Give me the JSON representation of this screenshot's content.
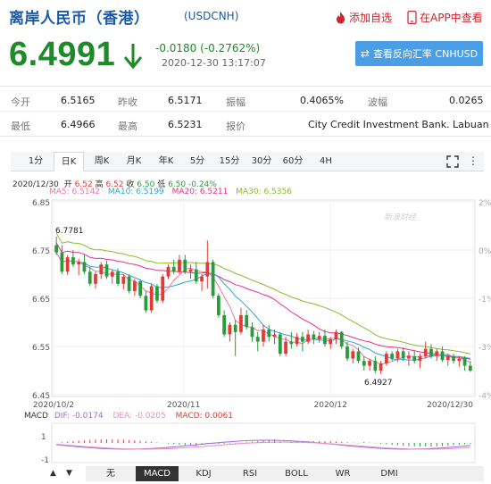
{
  "header": {
    "title": "离岸人民币（香港）",
    "symbol": "(USDCNH)",
    "favorite_label": "添加自选",
    "app_label": "在APP中查看"
  },
  "quote": {
    "price": "6.4991",
    "change": "-0.0180 (-0.2762%)",
    "datetime": "2020-12-30 13:17:07",
    "direction": "down",
    "reverse_button": "查看反向汇率 CNHUSD"
  },
  "stats": {
    "open_label": "今开",
    "open": "6.5165",
    "prev_close_label": "昨收",
    "prev_close": "6.5171",
    "amplitude_label": "振幅",
    "amplitude": "0.4065%",
    "wave_label": "波幅",
    "wave": "0.0265",
    "low_label": "最低",
    "low": "6.4966",
    "high_label": "最高",
    "high": "6.5231",
    "quote_label": "报价",
    "quote_source": "City Credit Investment Bank. Labuan"
  },
  "tabs": [
    "1分",
    "日K",
    "周K",
    "月K",
    "年K",
    "5分",
    "15分",
    "30分",
    "60分",
    "4H"
  ],
  "active_tab": "日K",
  "chart_info": {
    "date": "2020/12/30",
    "open_label": "开",
    "open": "6.52",
    "high_label": "高",
    "high": "6.52",
    "close_label": "收",
    "close": "6.50",
    "low_label": "低",
    "low": "6.50",
    "change": "-0.24%",
    "ma5": "MA5: 6.5142",
    "ma10": "MA10: 6.5199",
    "ma20": "MA20: 6.5211",
    "ma30": "MA30: 6.5356",
    "watermark": "新浪财经"
  },
  "macd_info": {
    "label": "MACD",
    "dif": "DIF: -0.0174",
    "dea": "DEA: -0.0205",
    "macd": "MACD: 0.0061"
  },
  "bottom_tabs": [
    "无",
    "MACD",
    "KDJ",
    "RSI",
    "BOLL",
    "WR",
    "DMI"
  ],
  "bottom_active": "MACD",
  "colors": {
    "up": "#e33a34",
    "down": "#2a9b3a",
    "ma5": "#e978a8",
    "ma10": "#28a7d8",
    "ma20": "#e8308a",
    "ma30": "#8fb92d",
    "dif": "#9a6be0",
    "dea": "#e88fbe",
    "brand": "#1a5aa6"
  },
  "chart_data": {
    "type": "candlestick",
    "y_ticks": [
      "6.85",
      "6.75",
      "6.65",
      "6.55",
      "6.45"
    ],
    "ylim": [
      6.45,
      6.85
    ],
    "pct_ticks": [
      "2%",
      "0%",
      "-1%",
      "-3%",
      "-4%"
    ],
    "x_ticks": [
      "2020/10/2",
      "2020/11",
      "2020/12",
      "2020/12/30"
    ],
    "annotations": {
      "max": "6.7781",
      "min": "6.4927"
    },
    "macd_ticks": [
      "1",
      "-1"
    ],
    "candles": [
      [
        6.76,
        6.778,
        6.74,
        6.745
      ],
      [
        6.745,
        6.76,
        6.7,
        6.705
      ],
      [
        6.705,
        6.74,
        6.698,
        6.735
      ],
      [
        6.735,
        6.75,
        6.715,
        6.72
      ],
      [
        6.72,
        6.732,
        6.698,
        6.725
      ],
      [
        6.725,
        6.74,
        6.7,
        6.705
      ],
      [
        6.705,
        6.715,
        6.675,
        6.68
      ],
      [
        6.68,
        6.705,
        6.67,
        6.7
      ],
      [
        6.7,
        6.725,
        6.69,
        6.72
      ],
      [
        6.72,
        6.728,
        6.69,
        6.695
      ],
      [
        6.695,
        6.71,
        6.68,
        6.705
      ],
      [
        6.705,
        6.712,
        6.675,
        6.68
      ],
      [
        6.68,
        6.7,
        6.668,
        6.695
      ],
      [
        6.695,
        6.7,
        6.66,
        6.665
      ],
      [
        6.665,
        6.69,
        6.655,
        6.685
      ],
      [
        6.685,
        6.688,
        6.65,
        6.655
      ],
      [
        6.655,
        6.665,
        6.62,
        6.625
      ],
      [
        6.625,
        6.68,
        6.62,
        6.675
      ],
      [
        6.675,
        6.68,
        6.64,
        6.645
      ],
      [
        6.645,
        6.7,
        6.64,
        6.695
      ],
      [
        6.695,
        6.72,
        6.69,
        6.715
      ],
      [
        6.715,
        6.73,
        6.7,
        6.705
      ],
      [
        6.705,
        6.74,
        6.7,
        6.73
      ],
      [
        6.73,
        6.74,
        6.7,
        6.705
      ],
      [
        6.705,
        6.72,
        6.69,
        6.71
      ],
      [
        6.71,
        6.725,
        6.68,
        6.685
      ],
      [
        6.685,
        6.7,
        6.665,
        6.695
      ],
      [
        6.695,
        6.77,
        6.67,
        6.725
      ],
      [
        6.725,
        6.73,
        6.65,
        6.655
      ],
      [
        6.655,
        6.66,
        6.61,
        6.615
      ],
      [
        6.615,
        6.625,
        6.57,
        6.575
      ],
      [
        6.575,
        6.6,
        6.56,
        6.595
      ],
      [
        6.595,
        6.605,
        6.53,
        6.58
      ],
      [
        6.58,
        6.63,
        6.575,
        6.615
      ],
      [
        6.615,
        6.625,
        6.585,
        6.59
      ],
      [
        6.59,
        6.6,
        6.56,
        6.57
      ],
      [
        6.57,
        6.58,
        6.54,
        6.56
      ],
      [
        6.56,
        6.595,
        6.55,
        6.585
      ],
      [
        6.585,
        6.595,
        6.56,
        6.57
      ],
      [
        6.57,
        6.585,
        6.555,
        6.575
      ],
      [
        6.575,
        6.58,
        6.53,
        6.535
      ],
      [
        6.535,
        6.57,
        6.53,
        6.56
      ],
      [
        6.56,
        6.58,
        6.545,
        6.555
      ],
      [
        6.555,
        6.578,
        6.55,
        6.57
      ],
      [
        6.57,
        6.58,
        6.54,
        6.56
      ],
      [
        6.56,
        6.585,
        6.555,
        6.575
      ],
      [
        6.575,
        6.582,
        6.555,
        6.565
      ],
      [
        6.565,
        6.58,
        6.558,
        6.572
      ],
      [
        6.572,
        6.585,
        6.55,
        6.555
      ],
      [
        6.555,
        6.57,
        6.545,
        6.565
      ],
      [
        6.565,
        6.585,
        6.555,
        6.58
      ],
      [
        6.58,
        6.582,
        6.545,
        6.55
      ],
      [
        6.55,
        6.56,
        6.52,
        6.525
      ],
      [
        6.525,
        6.545,
        6.515,
        6.54
      ],
      [
        6.54,
        6.548,
        6.515,
        6.52
      ],
      [
        6.52,
        6.53,
        6.5,
        6.51
      ],
      [
        6.51,
        6.525,
        6.5,
        6.52
      ],
      [
        6.52,
        6.53,
        6.495,
        6.5
      ],
      [
        6.5,
        6.52,
        6.493,
        6.515
      ],
      [
        6.515,
        6.54,
        6.51,
        6.535
      ],
      [
        6.535,
        6.54,
        6.52,
        6.525
      ],
      [
        6.525,
        6.545,
        6.518,
        6.54
      ],
      [
        6.54,
        6.548,
        6.52,
        6.525
      ],
      [
        6.525,
        6.54,
        6.51,
        6.53
      ],
      [
        6.53,
        6.54,
        6.515,
        6.52
      ],
      [
        6.52,
        6.535,
        6.505,
        6.53
      ],
      [
        6.53,
        6.56,
        6.525,
        6.545
      ],
      [
        6.545,
        6.555,
        6.525,
        6.53
      ],
      [
        6.53,
        6.545,
        6.52,
        6.54
      ],
      [
        6.54,
        6.55,
        6.518,
        6.522
      ],
      [
        6.522,
        6.535,
        6.51,
        6.53
      ],
      [
        6.53,
        6.535,
        6.515,
        6.52
      ],
      [
        6.52,
        6.53,
        6.508,
        6.525
      ],
      [
        6.525,
        6.53,
        6.5,
        6.51
      ],
      [
        6.51,
        6.52,
        6.497,
        6.5
      ]
    ]
  }
}
